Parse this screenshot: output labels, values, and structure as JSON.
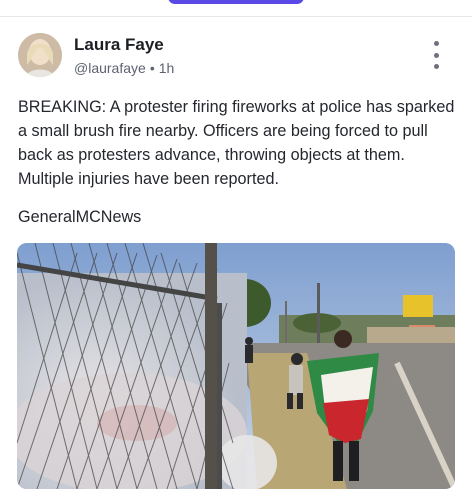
{
  "post": {
    "author_name": "Laura Faye",
    "handle": "@laurafaye",
    "separator": "•",
    "time": "1h",
    "body": "BREAKING: A protester firing fireworks at police has sparked a small brush fire nearby. Officers are being forced to pull back as protesters advance, throwing objects at them. Multiple injuries have been reported.",
    "source": "GeneralMCNews"
  },
  "icons": {
    "more": "more-vertical-icon"
  },
  "colors": {
    "accent": "#5a49e6",
    "text": "#25272e",
    "muted": "#5d6270"
  }
}
